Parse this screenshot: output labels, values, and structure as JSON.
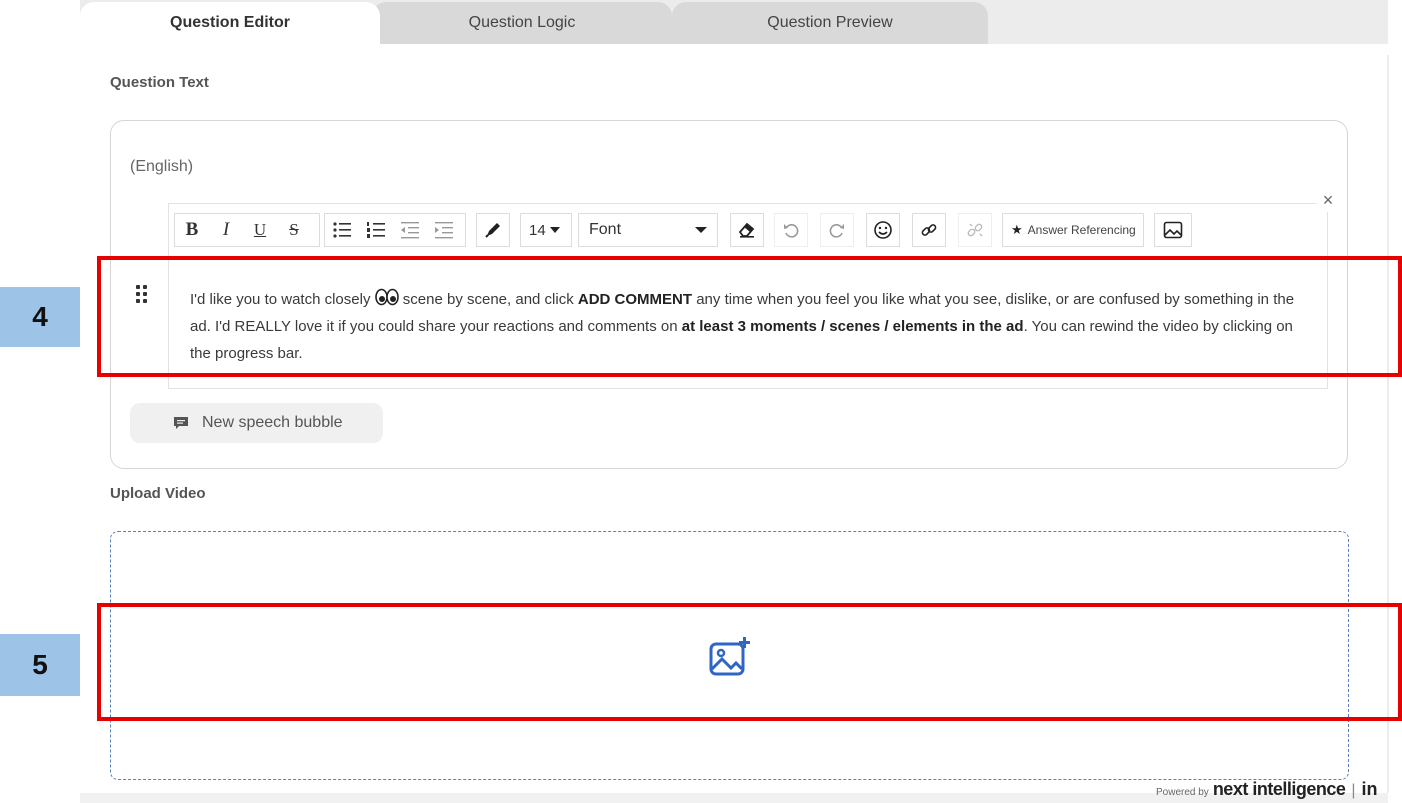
{
  "tabs": [
    {
      "label": "Question Editor",
      "active": true
    },
    {
      "label": "Question Logic",
      "active": false
    },
    {
      "label": "Question Preview",
      "active": false
    }
  ],
  "question_text": {
    "section_label": "Question Text",
    "language": "(English)",
    "close_symbol": "×",
    "toolbar": {
      "bold": "B",
      "italic": "I",
      "underline": "U",
      "strikethrough": "S",
      "font_size": "14",
      "font_label": "Font",
      "answer_referencing": "Answer Referencing"
    },
    "body": {
      "p1": "I'd like you to watch closely ",
      "p2": " scene by scene, and click ",
      "b1": "ADD COMMENT",
      "p3": " any time when you feel you like what you see, dislike, or are confused by something in the ad. I'd REALLY love it if you could share your reactions and comments on ",
      "b2": "at least 3 moments / scenes / elements in the ad",
      "p4": ". You can rewind the video by clicking on the progress bar."
    },
    "new_speech_bubble": "New speech bubble"
  },
  "upload_video": {
    "section_label": "Upload Video"
  },
  "annotations": {
    "badge_4": "4",
    "badge_5": "5",
    "color": "#e60000",
    "badge_color": "#9dc3e6"
  },
  "footer": {
    "powered_by": "Powered by",
    "brand": "next intelligence",
    "separator": "|",
    "brand_tail": "in"
  }
}
